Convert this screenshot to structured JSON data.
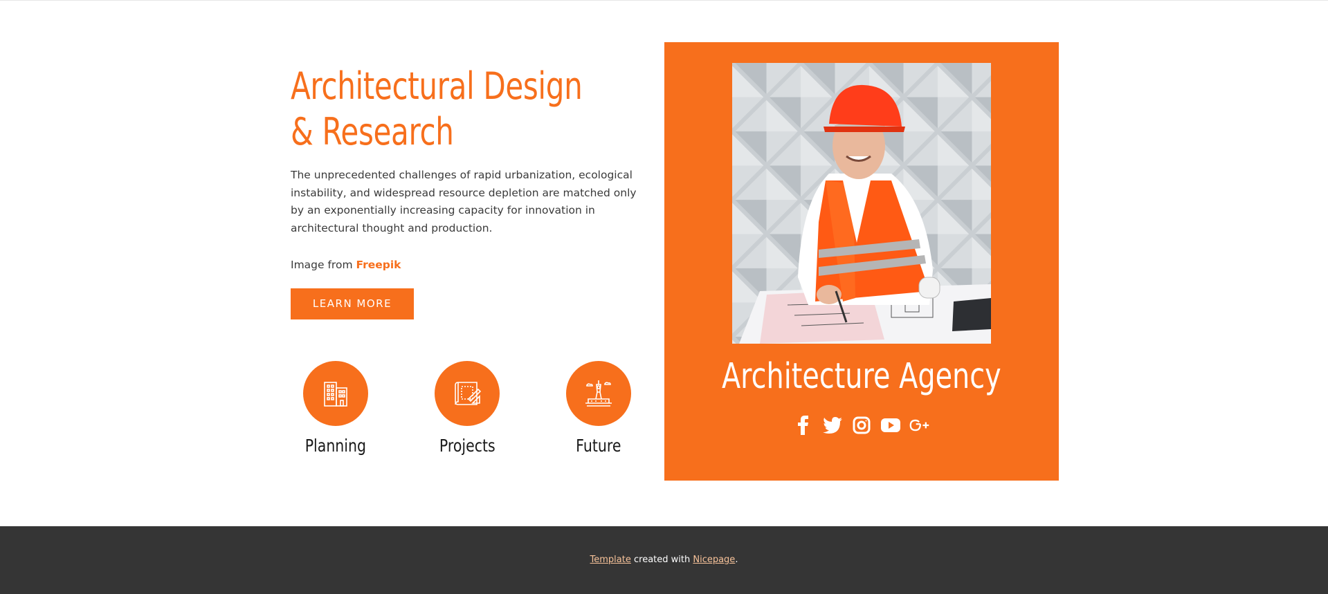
{
  "hero": {
    "title_line1": "Architectural Design",
    "title_line2": "& Research",
    "description": "The unprecedented challenges of rapid urbanization, ecological instability, and widespread resource depletion are matched only by an exponentially increasing capacity for innovation in architectural thought and production.",
    "credit_prefix": "Image from ",
    "credit_link": "Freepik",
    "button_label": "LEARN MORE"
  },
  "features": [
    {
      "label": "Planning",
      "icon": "building-icon"
    },
    {
      "label": "Projects",
      "icon": "blueprint-icon"
    },
    {
      "label": "Future",
      "icon": "city-tower-icon"
    }
  ],
  "panel": {
    "title": "Architecture Agency",
    "photo_icon": "engineer-photo",
    "social": [
      {
        "name": "facebook-icon"
      },
      {
        "name": "twitter-icon"
      },
      {
        "name": "instagram-icon"
      },
      {
        "name": "youtube-icon"
      },
      {
        "name": "google-plus-icon"
      }
    ]
  },
  "footer": {
    "template_link": "Template",
    "middle_text": " created with ",
    "nicepage_link": "Nicepage",
    "end_text": "."
  },
  "colors": {
    "accent": "#f76f1c",
    "footer_bg": "#353535",
    "footer_link": "#f8c39a"
  }
}
